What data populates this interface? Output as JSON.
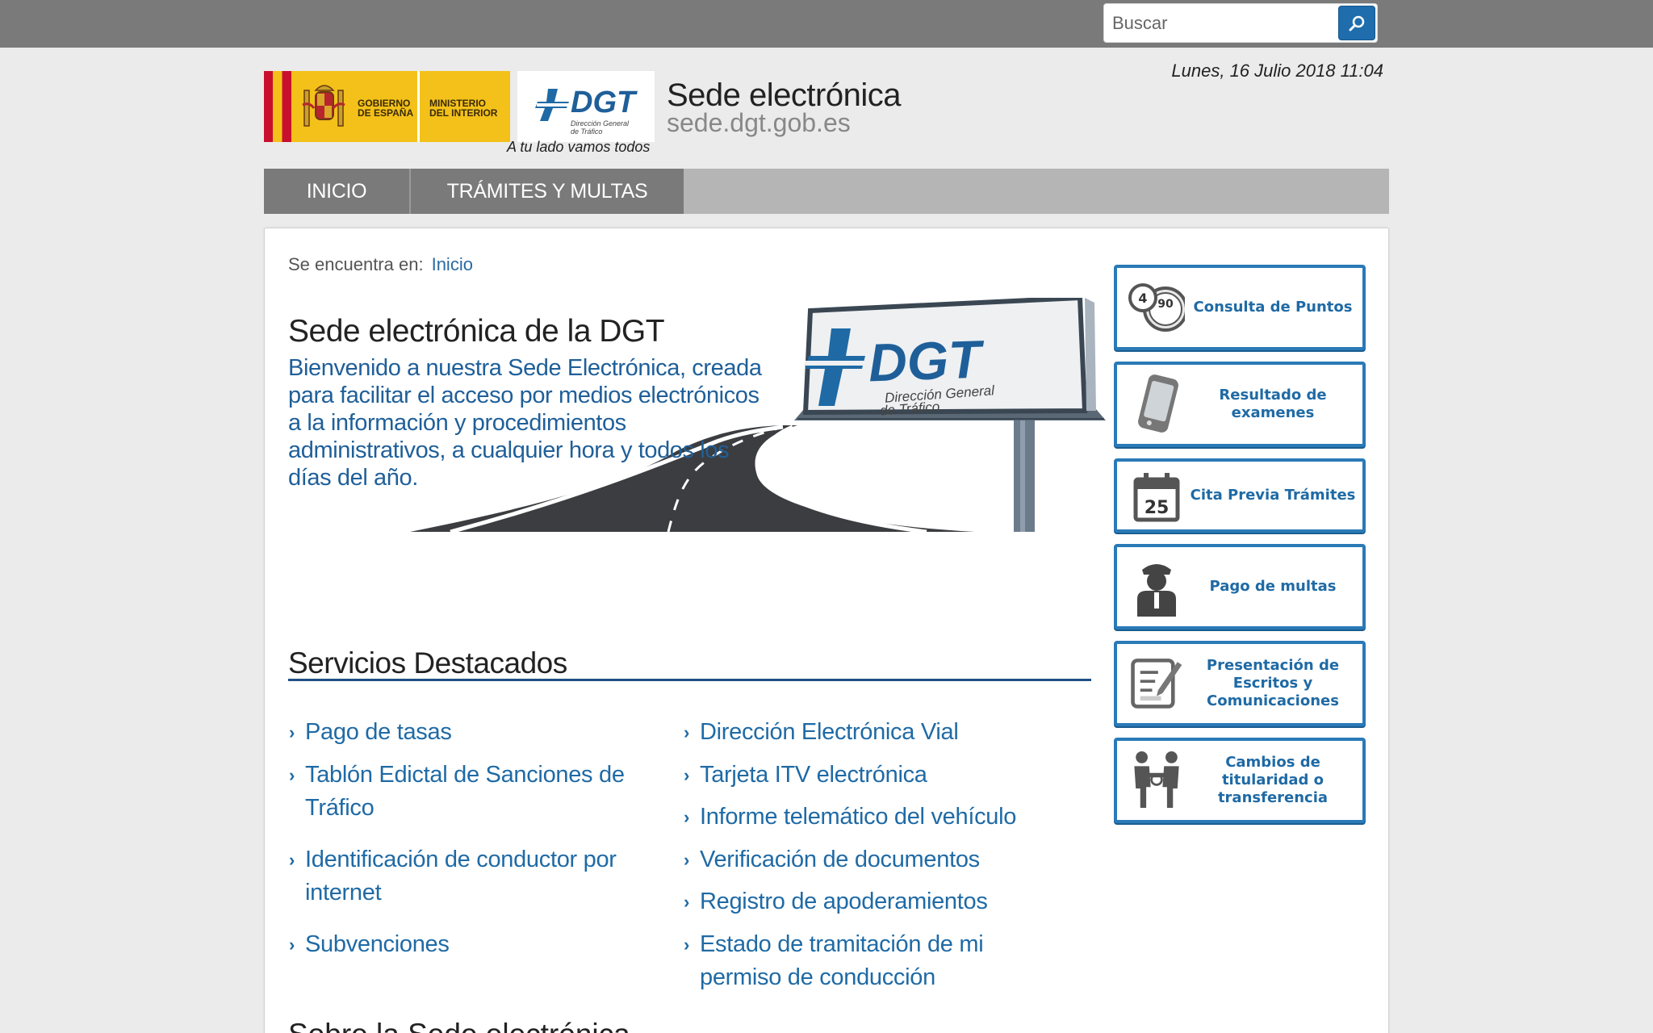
{
  "search": {
    "placeholder": "Buscar"
  },
  "header": {
    "date": "Lunes, 16 Julio 2018 11:04",
    "gov_line1": "GOBIERNO",
    "gov_line2": "DE ESPAÑA",
    "min_line1": "MINISTERIO",
    "min_line2": "DEL INTERIOR",
    "dgt_logo_text": "DGT",
    "dgt_logo_sub1": "Dirección General",
    "dgt_logo_sub2": "de Tráfico",
    "tagline": "A tu lado vamos todos",
    "site_title": "Sede electrónica",
    "site_url": "sede.dgt.gob.es"
  },
  "nav": {
    "items": [
      {
        "label": "INICIO"
      },
      {
        "label": "TRÁMITES Y MULTAS"
      }
    ]
  },
  "breadcrumb": {
    "prefix": "Se encuentra en:",
    "link": "Inicio"
  },
  "intro": {
    "title": "Sede electrónica de la DGT",
    "text": "Bienvenido a nuestra Sede Electrónica, creada para facilitar el acceso por medios electrónicos a la información y procedimientos administrativos, a cualquier hora y todos los días del año.",
    "billboard_logo": "DGT",
    "billboard_sub1": "Dirección General",
    "billboard_sub2": "de Tráfico"
  },
  "servicios": {
    "title": "Servicios Destacados",
    "left": [
      "Pago de tasas",
      "Tablón Edictal de Sanciones de Tráfico",
      "Identificación de conductor por internet",
      "Subvenciones"
    ],
    "right": [
      "Dirección Electrónica Vial",
      "Tarjeta ITV electrónica",
      "Informe telemático del vehículo",
      "Verificación de documentos",
      "Registro de apoderamientos",
      "Estado de tramitación de mi permiso de conducción"
    ]
  },
  "next_section": {
    "title": "Sobre la Sede electrónica"
  },
  "side": {
    "items": [
      {
        "label": "Consulta de Puntos",
        "icon": "points-icon"
      },
      {
        "label": "Resultado de examenes",
        "icon": "phone-icon"
      },
      {
        "label": "Cita Previa Trámites",
        "icon": "calendar-icon",
        "day": "25"
      },
      {
        "label": "Pago de multas",
        "icon": "officer-icon"
      },
      {
        "label": "Presentación de Escritos y Comunicaciones",
        "icon": "document-icon"
      },
      {
        "label": "Cambios de titularidad o transferencia",
        "icon": "handshake-icon"
      }
    ]
  },
  "colors": {
    "primary": "#2a7ab7",
    "link": "#1f6aa5",
    "topbar": "#7a7a7a",
    "nav": "#7a7a7a"
  }
}
